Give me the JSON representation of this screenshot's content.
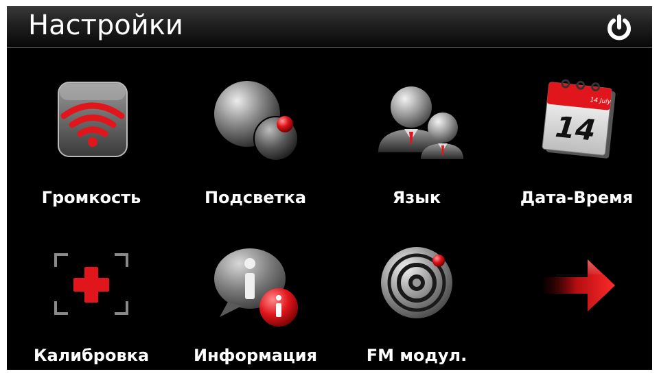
{
  "header": {
    "title": "Настройки",
    "power_icon": "power-icon"
  },
  "tiles": [
    {
      "label": "Громкость",
      "icon": "volume-icon"
    },
    {
      "label": "Подсветка",
      "icon": "backlight-icon"
    },
    {
      "label": "Язык",
      "icon": "language-icon"
    },
    {
      "label": "Дата-Время",
      "icon": "calendar-icon",
      "calendar_day": "14",
      "calendar_month": "14 July"
    },
    {
      "label": "Калибровка",
      "icon": "calibration-icon"
    },
    {
      "label": "Информация",
      "icon": "info-icon"
    },
    {
      "label": "FM модул.",
      "icon": "fm-transmitter-icon"
    },
    {
      "label": "",
      "icon": "next-page-arrow-icon"
    }
  ],
  "colors": {
    "accent": "#e0161c",
    "background": "#000000",
    "text": "#ffffff"
  }
}
